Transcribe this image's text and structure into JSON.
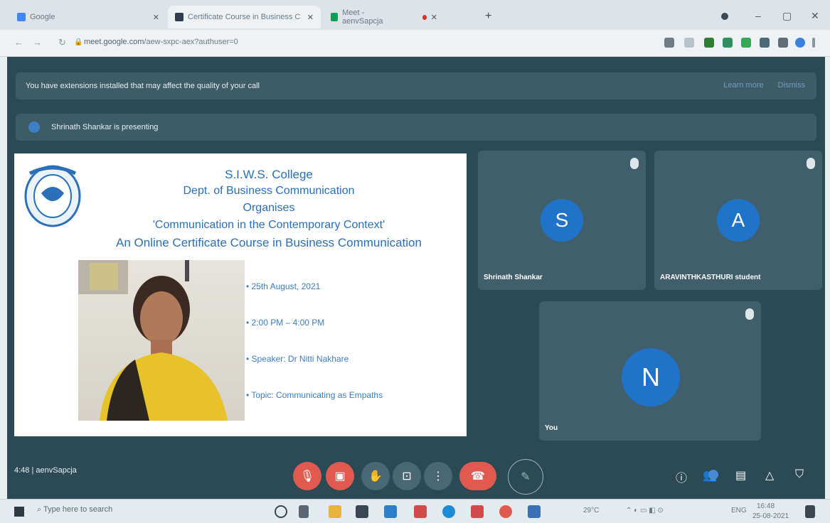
{
  "browser": {
    "tabs": [
      {
        "title": "Google",
        "active": false
      },
      {
        "title": "Certificate Course in Business C",
        "active": true
      },
      {
        "title": "Meet - aenvSapcja",
        "active": false
      }
    ],
    "address": {
      "domain": "meet.google.com",
      "path": "/aew-sxpc-aex?authuser=0"
    }
  },
  "meet": {
    "extensions_banner": {
      "text": "You have extensions installed that may affect the quality of your call",
      "actions": [
        "Learn more",
        "Dismiss"
      ]
    },
    "presenting_banner": "Shrinath Shankar is presenting",
    "slide": {
      "line1": "S.I.W.S. College",
      "line2": "Dept. of Business Communication",
      "line3": "Organises",
      "line4": "'Communication in the Contemporary Context'",
      "line5": "An Online Certificate Course in Business Communication",
      "bullets": [
        "25th August, 2021",
        "2:00 PM – 4:00 PM",
        "Speaker: Dr Nitti Nakhare",
        "Topic: Communicating as Empaths"
      ]
    },
    "participants": [
      {
        "initial": "S",
        "name": "Shrinath Shankar"
      },
      {
        "initial": "A",
        "name": "ARAVINTHKASTHURI student"
      },
      {
        "initial": "N",
        "name": "You"
      }
    ],
    "meeting_info": {
      "time": "4:48",
      "code": "aenvSapcja"
    }
  },
  "taskbar": {
    "search_placeholder": "Type here to search",
    "tray": {
      "weather": "29°C",
      "lang": "ENG",
      "time": "16:48",
      "date": "25-08-2021"
    }
  },
  "colors": {
    "meet_bg": "#2c4a55",
    "tile_bg": "#405e6b",
    "avatar": "#1f74c9",
    "danger": "#e05a50",
    "slide_text": "#2a6fb8"
  }
}
